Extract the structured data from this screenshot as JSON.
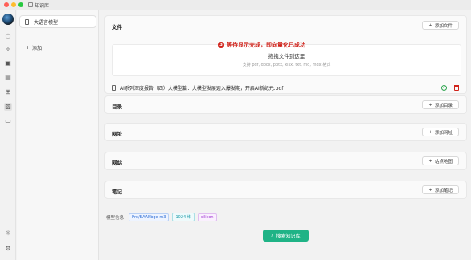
{
  "window": {
    "title": "知识库"
  },
  "rail": {
    "icons": [
      "chat-icon",
      "sparkle-icon",
      "image-icon",
      "translate-icon",
      "apps-icon",
      "knowledge-icon",
      "folder-icon",
      "sun-icon",
      "settings-icon"
    ]
  },
  "kb_list": {
    "items": [
      {
        "label": "大语言模型"
      }
    ],
    "add_label": "添加"
  },
  "sections": {
    "files": {
      "title": "文件",
      "button": "添加文件"
    },
    "directory": {
      "title": "目录",
      "button": "添加目录"
    },
    "url": {
      "title": "网址",
      "button": "添加网址"
    },
    "website": {
      "title": "网站",
      "button": "站点地图"
    },
    "notes": {
      "title": "笔记",
      "button": "添加笔记"
    }
  },
  "dropzone": {
    "title": "拖拽文件到这里",
    "hint": "支持 pdf, docx, pptx, xlsx, txt, md, mdx 格式"
  },
  "callout": {
    "number": "3",
    "text": "等待显示完成，即向量化已成功"
  },
  "file": {
    "name": "AI系列深度报告（四）大模型篇：大模型发展迈入爆发期，开启AI新纪元.pdf",
    "status": "success"
  },
  "model_info": {
    "label": "模型信息",
    "tags": [
      "Pro/BAAI/bge-m3",
      "1024 维",
      "silicon"
    ]
  },
  "search_button": "搜索知识库",
  "colors": {
    "accent": "#1fb386",
    "callout": "#d0231b",
    "success": "#2ea44f",
    "danger": "#d0231b"
  }
}
